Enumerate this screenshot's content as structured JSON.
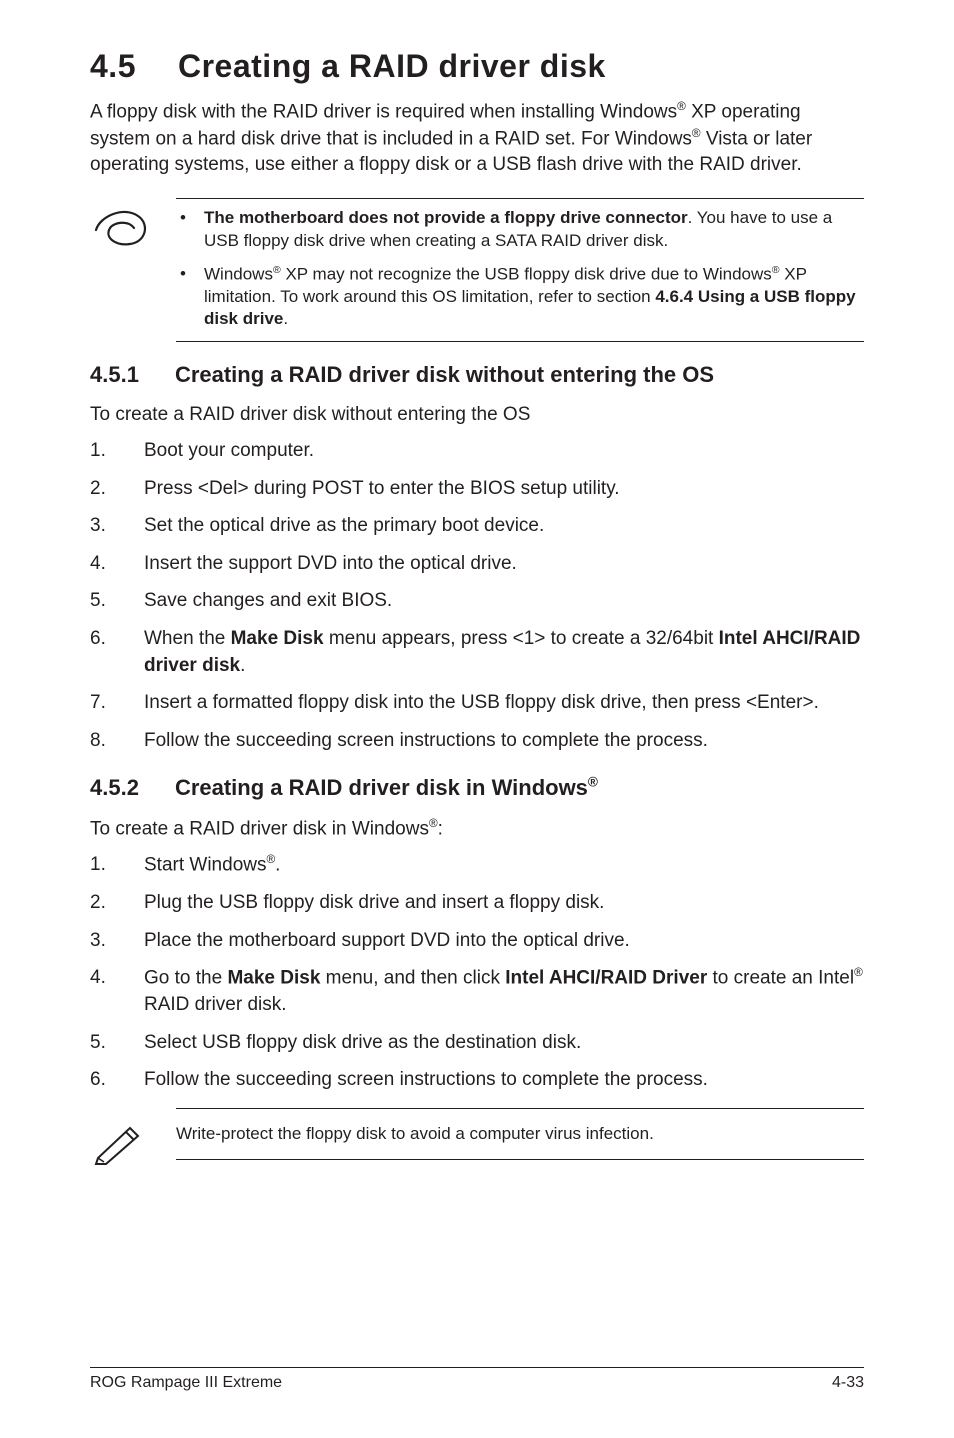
{
  "header": {
    "section_number": "4.5",
    "section_title": "Creating a RAID driver disk",
    "intro_html": "A floppy disk with the RAID driver is required when installing Windows<span class=\"sup\">®</span> XP operating system on a hard disk drive that is included in a RAID set. For Windows<span class=\"sup\">®</span> Vista or later operating systems, use either a floppy disk or a USB flash drive with the RAID driver."
  },
  "tip_box": {
    "items": [
      "<b>The motherboard does not provide a floppy drive connector</b>. You have to use a USB floppy disk drive when creating a SATA RAID driver disk.",
      "Windows<span class=\"sup\">®</span> XP may not recognize the USB floppy disk drive due to Windows<span class=\"sup\">®</span> XP limitation. To work around this OS limitation, refer to section <b>4.6.4 Using a USB floppy disk drive</b>."
    ]
  },
  "subsection1": {
    "number": "4.5.1",
    "title": "Creating a RAID driver disk without entering the OS",
    "lead": "To create a RAID driver disk without entering the OS",
    "steps": [
      "Boot your computer.",
      "Press <Del> during POST to enter the BIOS setup utility.",
      "Set the optical drive as the primary boot device.",
      "Insert the support DVD into the optical drive.",
      "Save changes and exit BIOS.",
      "When the <b>Make Disk</b> menu appears, press <1> to create a 32/64bit <b>Intel AHCI/RAID driver disk</b>.",
      "Insert a formatted floppy disk into the USB floppy disk drive, then press <Enter>.",
      "Follow the succeeding screen instructions to complete the process."
    ]
  },
  "subsection2": {
    "number": "4.5.2",
    "title_html": "Creating a RAID driver disk in Windows<span class=\"sup\">®</span>",
    "lead_html": "To create a RAID driver disk in Windows<span class=\"sup\">®</span>:",
    "steps": [
      "Start Windows<span class=\"sup\">®</span>.",
      "Plug the USB floppy disk drive and insert a floppy disk.",
      "Place the motherboard support DVD into the optical drive.",
      "Go to the <b>Make Disk</b> menu, and then click <b>Intel AHCI/RAID Driver</b> to create an Intel<span class=\"sup\">®</span> RAID driver disk.",
      "Select USB floppy disk drive as the destination disk.",
      "Follow the succeeding screen instructions to complete the process."
    ]
  },
  "note_box": {
    "text": "Write-protect the floppy disk to avoid a computer virus infection."
  },
  "footer": {
    "left": "ROG Rampage III Extreme",
    "right": "4-33"
  }
}
